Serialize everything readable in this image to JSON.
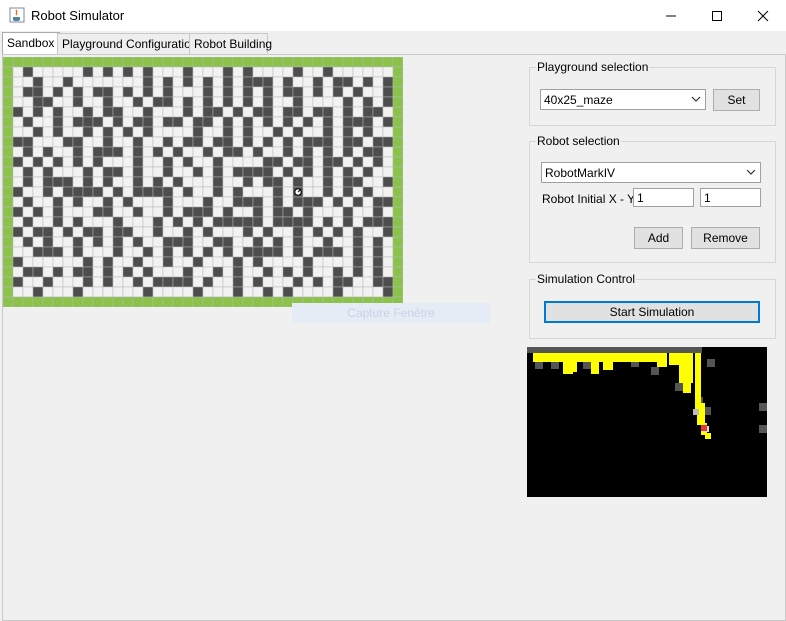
{
  "window": {
    "title": "Robot Simulator"
  },
  "tabs": [
    {
      "label": "Sandbox",
      "active": true
    },
    {
      "label": "Playground Configuration",
      "active": false
    },
    {
      "label": "Robot Building",
      "active": false
    }
  ],
  "board": {
    "cols": 40,
    "rows": 25,
    "colors": {
      "wall": "#4d4d4d",
      "free": "#f2f2f2",
      "border": "#8bc34a",
      "grid": "#b5b5b5"
    },
    "robot": {
      "col": 29,
      "row": 13
    }
  },
  "overlay": {
    "capture_label": "Capture Fenêtre"
  },
  "playground": {
    "title": "Playground selection",
    "selected": "40x25_maze",
    "set_label": "Set"
  },
  "robot_selection": {
    "title": "Robot selection",
    "selected": "RobotMarkIV",
    "initial_label": "Robot Initial X - Y:",
    "x_value": "1",
    "y_value": "1",
    "add_label": "Add",
    "remove_label": "Remove"
  },
  "simulation": {
    "title": "Simulation Control",
    "start_label": "Start Simulation"
  },
  "minimap": {
    "colors": {
      "background": "#000000",
      "path": "#ffff00",
      "wall": "#555555",
      "robot": "#e53935"
    }
  }
}
